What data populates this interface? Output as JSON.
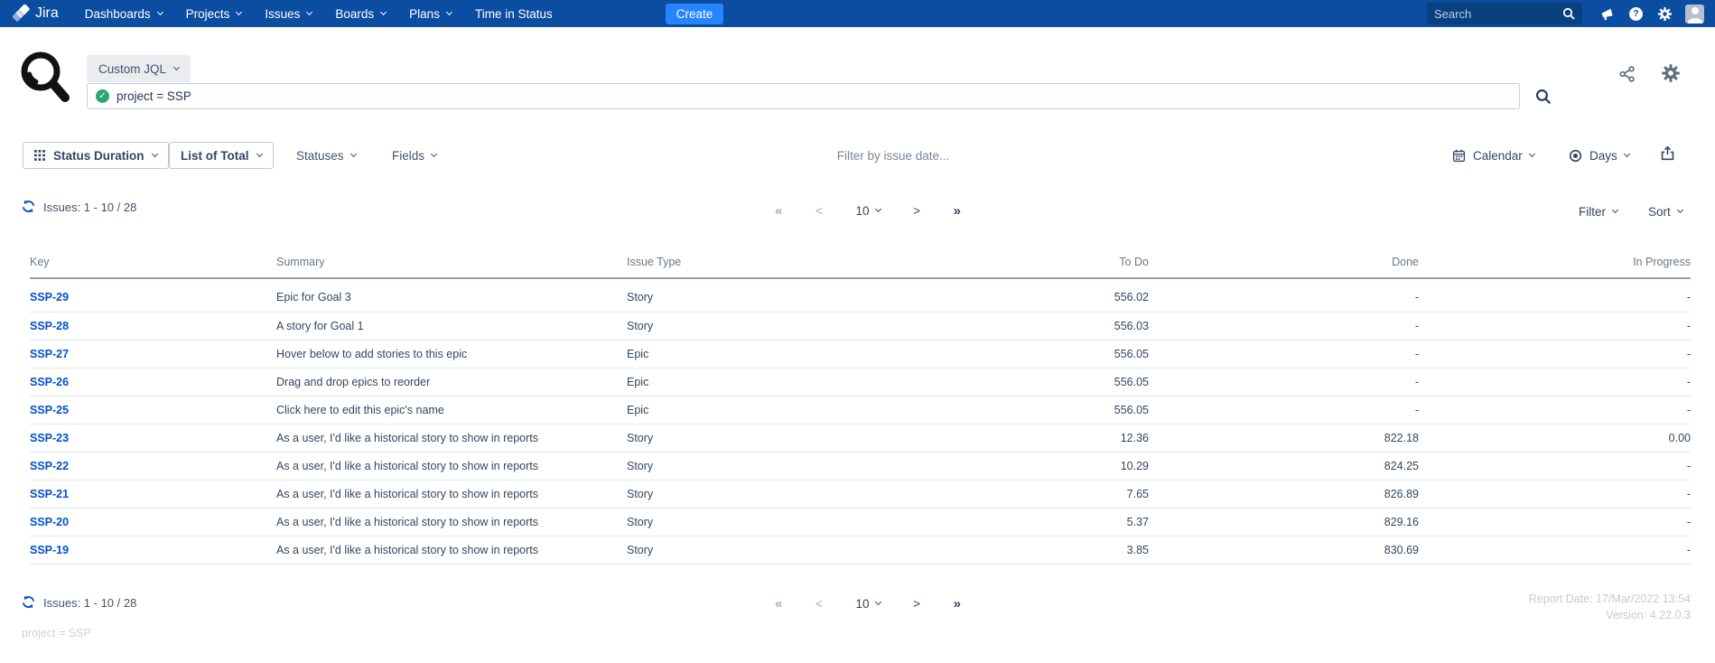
{
  "colors": {
    "navbar": "#0B4DA1",
    "create_button": "#2684FF",
    "link": "#0052CC",
    "success_check": "#2BA770",
    "text_primary": "#344563",
    "column_header": "#6B778C",
    "footer_muted": "#C5CAD3"
  },
  "nav": {
    "brand": "Jira",
    "items": [
      {
        "label": "Dashboards"
      },
      {
        "label": "Projects"
      },
      {
        "label": "Issues"
      },
      {
        "label": "Boards"
      },
      {
        "label": "Plans"
      },
      {
        "label": "Time in Status"
      }
    ],
    "create_label": "Create",
    "search_placeholder": "Search",
    "help_glyph": "?"
  },
  "query_bar": {
    "mode_label": "Custom JQL",
    "jql_valid_glyph": "✓",
    "jql_value": "project = SSP"
  },
  "toolbar": {
    "view_label": "Status Duration",
    "calc_label": "List of Total",
    "statuses_label": "Statuses",
    "fields_label": "Fields",
    "date_filter_placeholder": "Filter by issue date...",
    "calendar_label": "Calendar",
    "unit_label": "Days"
  },
  "results_bar": {
    "count_label": "Issues: 1 - 10 / 28",
    "first_symbol": "«",
    "prev_symbol": "<",
    "page_size": "10",
    "next_symbol": ">",
    "last_symbol": "»",
    "filter_label": "Filter",
    "sort_label": "Sort"
  },
  "table": {
    "columns": [
      "Key",
      "Summary",
      "Issue Type",
      "To Do",
      "Done",
      "In Progress"
    ],
    "rows": [
      {
        "key": "SSP-29",
        "summary": "Epic for Goal 3",
        "issue_type": "Story",
        "to_do": "556.02",
        "done": "-",
        "in_progress": "-"
      },
      {
        "key": "SSP-28",
        "summary": "A story for Goal 1",
        "issue_type": "Story",
        "to_do": "556.03",
        "done": "-",
        "in_progress": "-"
      },
      {
        "key": "SSP-27",
        "summary": "Hover below to add stories to this epic",
        "issue_type": "Epic",
        "to_do": "556.05",
        "done": "-",
        "in_progress": "-"
      },
      {
        "key": "SSP-26",
        "summary": "Drag and drop epics to reorder",
        "issue_type": "Epic",
        "to_do": "556.05",
        "done": "-",
        "in_progress": "-"
      },
      {
        "key": "SSP-25",
        "summary": "Click here to edit this epic's name",
        "issue_type": "Epic",
        "to_do": "556.05",
        "done": "-",
        "in_progress": "-"
      },
      {
        "key": "SSP-23",
        "summary": "As a user, I'd like a historical story to show in reports",
        "issue_type": "Story",
        "to_do": "12.36",
        "done": "822.18",
        "in_progress": "0.00"
      },
      {
        "key": "SSP-22",
        "summary": "As a user, I'd like a historical story to show in reports",
        "issue_type": "Story",
        "to_do": "10.29",
        "done": "824.25",
        "in_progress": "-"
      },
      {
        "key": "SSP-21",
        "summary": "As a user, I'd like a historical story to show in reports",
        "issue_type": "Story",
        "to_do": "7.65",
        "done": "826.89",
        "in_progress": "-"
      },
      {
        "key": "SSP-20",
        "summary": "As a user, I'd like a historical story to show in reports",
        "issue_type": "Story",
        "to_do": "5.37",
        "done": "829.16",
        "in_progress": "-"
      },
      {
        "key": "SSP-19",
        "summary": "As a user, I'd like a historical story to show in reports",
        "issue_type": "Story",
        "to_do": "3.85",
        "done": "830.69",
        "in_progress": "-"
      }
    ]
  },
  "footer": {
    "count_label": "Issues: 1 - 10 / 28",
    "report_date": "Report Date: 17/Mar/2022 13:54",
    "version": "Version: 4.22.0.3",
    "jql_echo": "project = SSP"
  }
}
